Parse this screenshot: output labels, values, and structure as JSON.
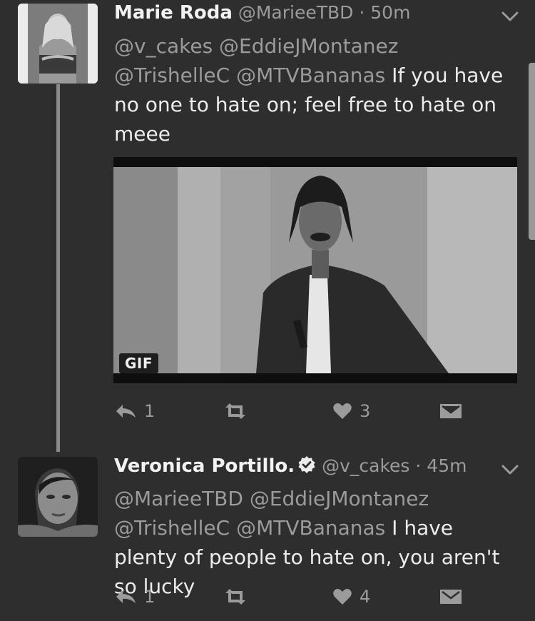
{
  "tweets": [
    {
      "name": "Marie Roda",
      "handle": "@MarieeTBD",
      "time": "· 50m",
      "mentions": "@v_cakes @EddieJMontanez @TrishelleC @MTVBananas",
      "text": " If you have no one to hate on; feel free to hate on meee",
      "media_badge": "GIF",
      "reply_count": "1",
      "like_count": "3"
    },
    {
      "name": "Veronica Portillo.",
      "verified": true,
      "handle": "@v_cakes",
      "time": "· 45m",
      "mentions": "@MarieeTBD @EddieJMontanez @TrishelleC @MTVBananas",
      "text": " I have plenty of people to hate on, you aren't so lucky",
      "reply_count": "1",
      "like_count": "4"
    }
  ],
  "colors": {
    "background": "#2e2e2e",
    "text": "#ececec",
    "muted": "#9b9b9b",
    "thread_line": "#8a8a8a"
  }
}
